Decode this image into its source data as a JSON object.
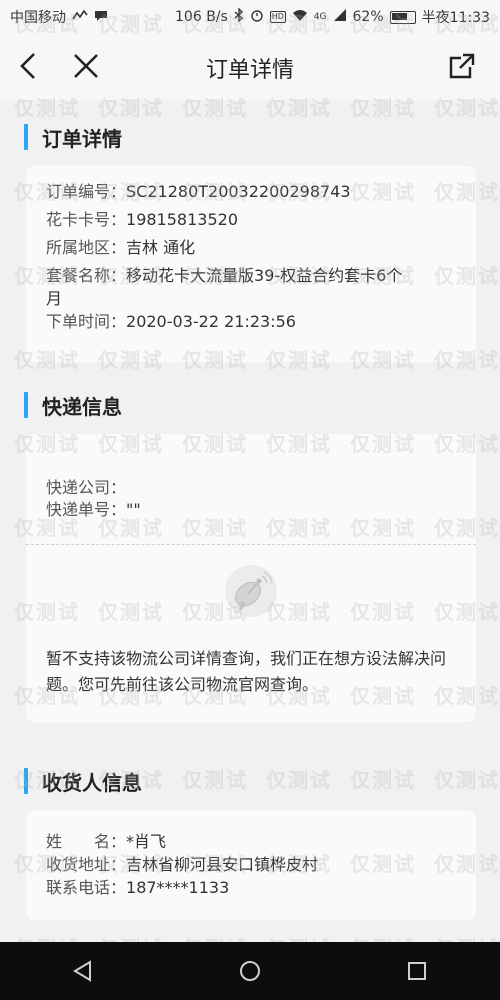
{
  "status_bar": {
    "carrier": "中国移动",
    "speed": "106 B/s",
    "hd_badge": "HD",
    "net_badge": "4G",
    "battery": "62%",
    "time": "半夜11:33"
  },
  "nav": {
    "title": "订单详情"
  },
  "order": {
    "heading": "订单详情",
    "number_label": "订单编号：",
    "number": "SC21280T20032200298743",
    "card_label": "花卡卡号：",
    "card": "19815813520",
    "region_label": "所属地区：",
    "region": "吉林 通化",
    "plan_label": "套餐名称：",
    "plan_line1": "移动花卡大流量版39-权益合约套卡6个",
    "plan_line2": "月",
    "time_label": "下单时间：",
    "time": "2020-03-22 21:23:56"
  },
  "express": {
    "heading": "快递信息",
    "company_label": "快递公司：",
    "company": "",
    "tracking_label": "快递单号：",
    "tracking": "\"\"",
    "notice": "暂不支持该物流公司详情查询，我们正在想方设法解决问题。您可先前往该公司物流官网查询。"
  },
  "receiver": {
    "heading": "收货人信息",
    "name_label": "姓　　名：",
    "name": "*肖飞",
    "address_label": "收货地址：",
    "address": "吉林省柳河县安口镇桦皮村",
    "phone_label": "联系电话：",
    "phone": "187****1133"
  },
  "watermark": {
    "text": "仅测试"
  },
  "icons": [
    "back-arrow-icon",
    "close-icon",
    "share-icon",
    "satellite-dish-icon",
    "nav-back-icon",
    "nav-home-icon",
    "nav-recents-icon"
  ],
  "colors": {
    "accent": "#2aa6ee",
    "background": "#f1f1f3",
    "card": "#fafafa",
    "bottom_nav": "#0d0d0d"
  }
}
